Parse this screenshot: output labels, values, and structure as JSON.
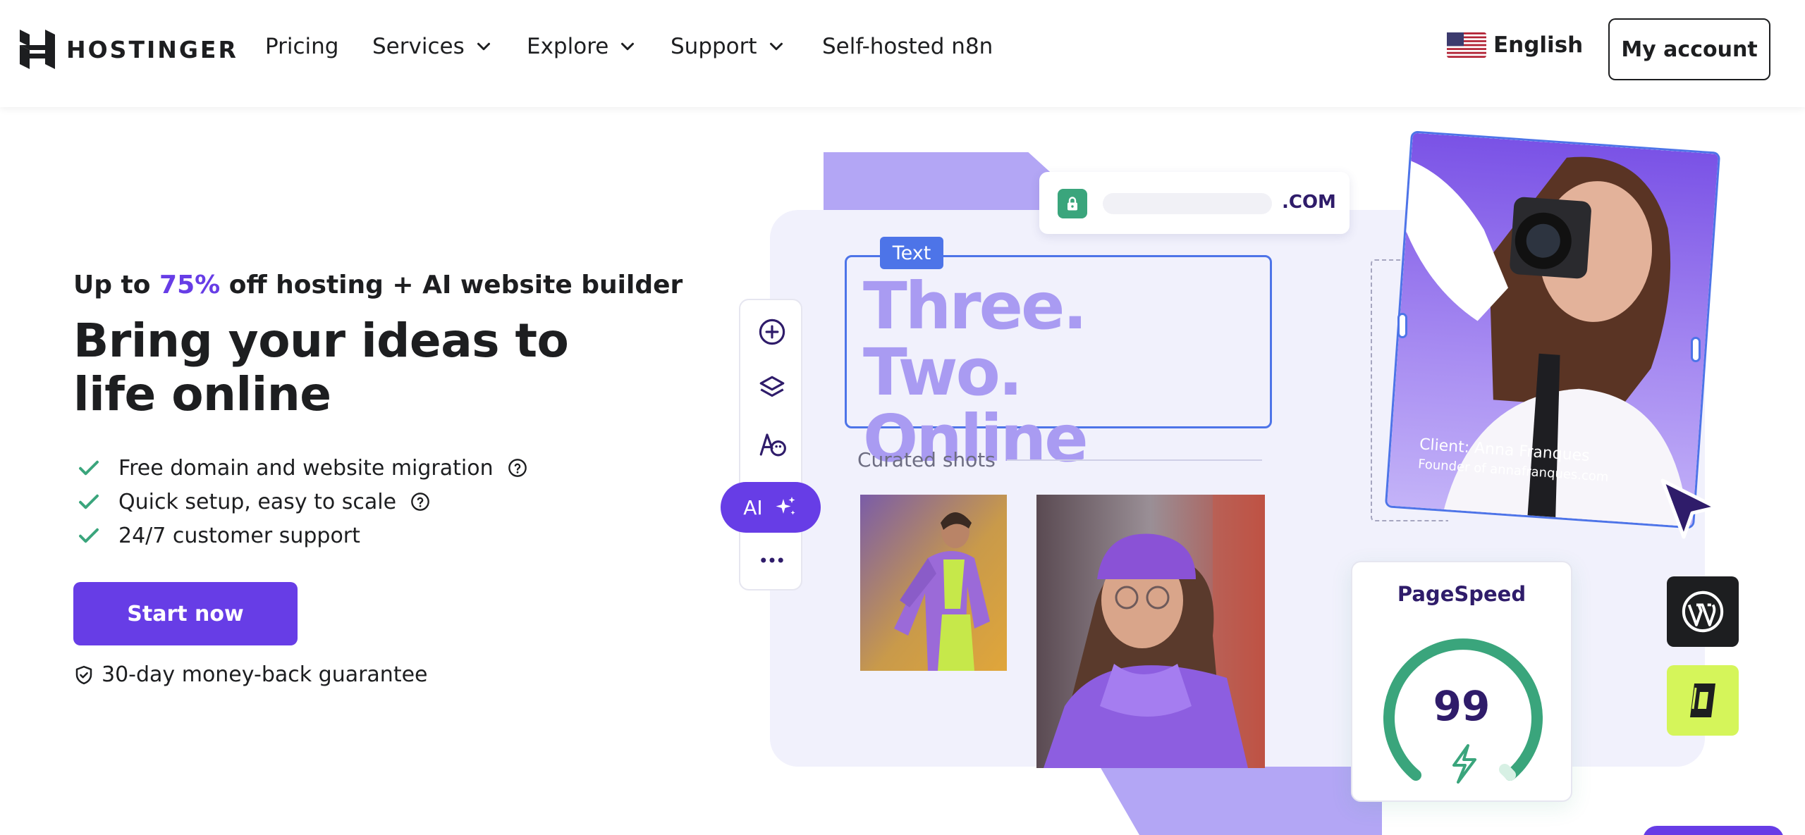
{
  "header": {
    "logo_text": "HOSTINGER",
    "nav": {
      "pricing": "Pricing",
      "services": "Services",
      "explore": "Explore",
      "support": "Support",
      "n8n": "Self-hosted n8n"
    },
    "language": "English",
    "account_button": "My account"
  },
  "hero": {
    "promo_prefix": "Up to ",
    "promo_percent": "75%",
    "promo_suffix": " off hosting + AI website builder",
    "headline": "Bring your ideas to life online",
    "features": [
      "Free domain and website migration",
      "Quick setup, easy to scale",
      "24/7 customer support"
    ],
    "cta": "Start now",
    "guarantee": "30-day money-back guarantee"
  },
  "illustration": {
    "url_tld": ".COM",
    "text_tag": "Text",
    "text_title": "Three. Two. Online",
    "curated_label": "Curated shots",
    "ai_button": "AI",
    "client_name": "Client: Anna Franques",
    "client_role": "Founder of annafranques.com",
    "pagespeed_title": "PageSpeed",
    "pagespeed_score": "99"
  },
  "colors": {
    "brand_purple": "#673de6",
    "light_purple": "#b3a6f5",
    "selection_blue": "#4d74e8",
    "green": "#3aa57c",
    "lime": "#d5f55a"
  },
  "icons": [
    "hostinger-logo-icon",
    "chevron-down-icon",
    "us-flag-icon",
    "check-icon",
    "help-icon",
    "shield-icon",
    "lock-icon",
    "plus-circle-icon",
    "layers-icon",
    "palette-icon",
    "sparkles-icon",
    "more-icon",
    "cursor-icon",
    "lightning-icon",
    "wordpress-icon",
    "lime-brand-icon"
  ]
}
